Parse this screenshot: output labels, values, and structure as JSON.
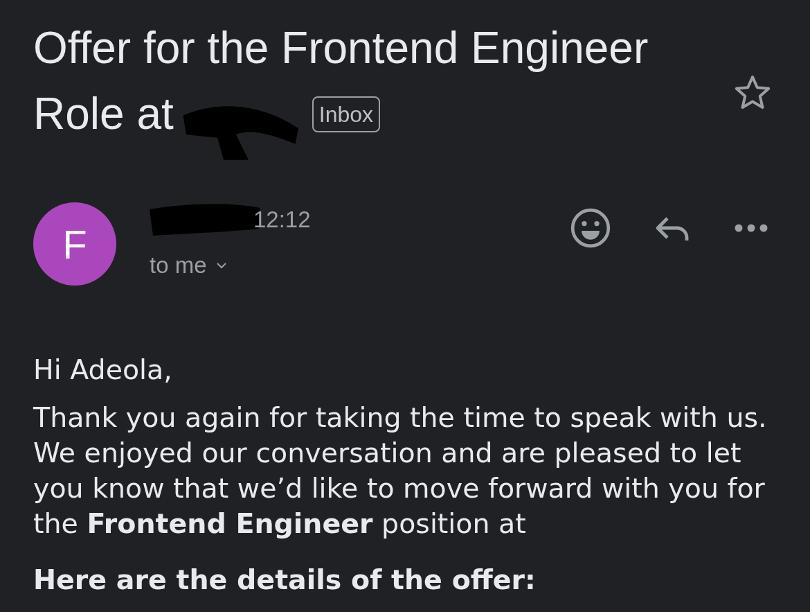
{
  "subject": {
    "title_lines": [
      "Offer for the Frontend Engineer",
      "Role at"
    ],
    "label": "Inbox",
    "starred": false
  },
  "sender": {
    "avatar_letter": "F",
    "time": "12:12",
    "recipient": "to me"
  },
  "body": {
    "greeting": "Hi Adeola,",
    "paragraph": "Thank you again for taking the time to speak with us. We enjoyed our conversation and are pleased to let you know that we’d like to move forward with you for the **Frontend Engineer** position at",
    "heading": "Here are the details of the offer:"
  }
}
